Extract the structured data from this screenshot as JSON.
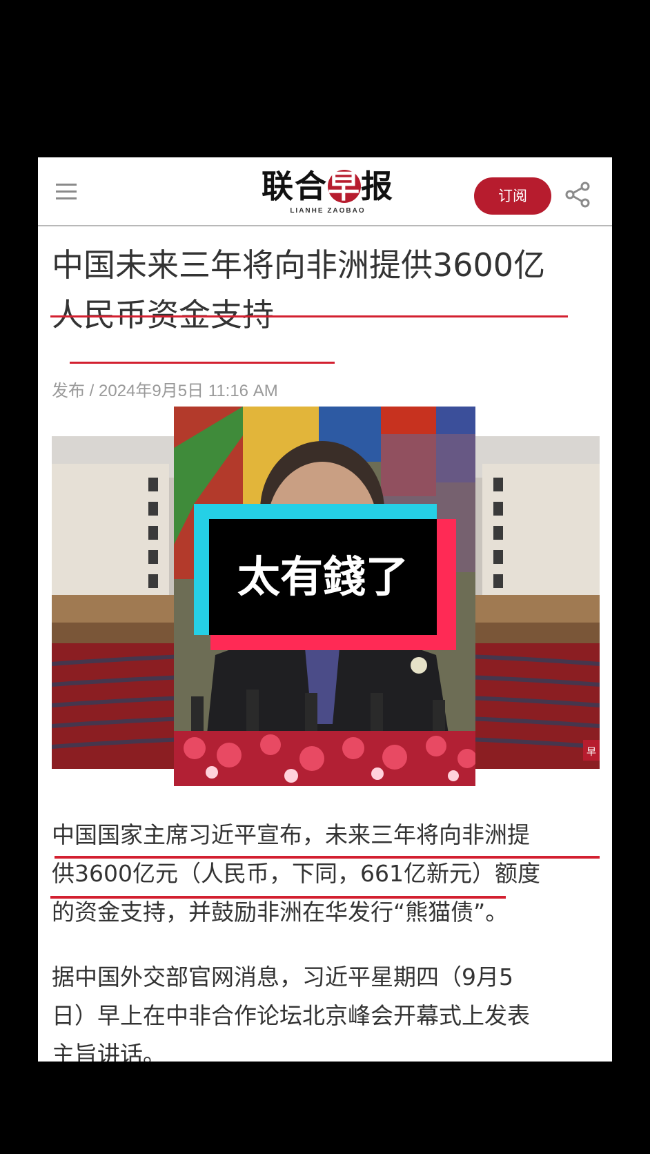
{
  "header": {
    "logo_text": "联合早报",
    "logo_sub": "LIANHE ZAOBAO",
    "subscribe_label": "订阅",
    "menu_icon": "hamburger-menu-icon",
    "share_icon": "share-icon"
  },
  "article": {
    "title_line1": "中国未来三年将向非洲提供3600亿",
    "title_line2": "人民币资金支持",
    "date": "发布 / 2024年9月5日 11:16 AM",
    "paragraph1_line1": "中国国家主席习近平宣布，未来三年将向非洲提",
    "paragraph1_line2": "供3600亿元（人民币，下同，661亿新元）额度",
    "paragraph1_line3": "的资金支持，并鼓励非洲在华发行“熊猫债”。",
    "paragraph2_line1": "据中国外交部官网消息，习近平星期四（9月5",
    "paragraph2_line2": "日）早上在中非合作论坛北京峰会开幕式上发表",
    "paragraph2_line3": "主旨讲话。",
    "image_watermark": "早"
  },
  "overlay": {
    "caption": "太有錢了"
  },
  "colors": {
    "brand_red": "#b71c2e",
    "underline_red": "#d32030",
    "caption_cyan": "#25d0e6",
    "caption_pink": "#ff2a55"
  }
}
